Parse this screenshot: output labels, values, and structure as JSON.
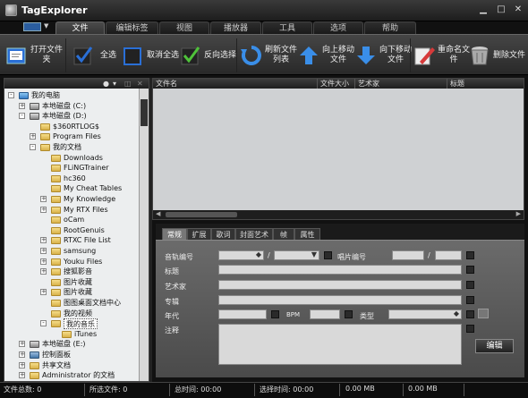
{
  "app": {
    "title": "TagExplorer"
  },
  "tabs": [
    "文件",
    "编辑标签",
    "视图",
    "播放器",
    "工具",
    "选项",
    "帮助"
  ],
  "ribbon": {
    "open_folder": "打开文件夹",
    "select_all": "全选",
    "deselect_all": "取消全选",
    "invert": "反向选择",
    "refresh": "刷新文件列表",
    "move_up": "向上移动文件",
    "move_down": "向下移动文件",
    "rename": "重命名文件",
    "delete": "删除文件"
  },
  "tree": [
    {
      "label": "我的电脑",
      "level": 0,
      "exp": "-",
      "icon": "computer"
    },
    {
      "label": "本地磁盘 (C:)",
      "level": 1,
      "exp": "+",
      "icon": "drive"
    },
    {
      "label": "本地磁盘 (D:)",
      "level": 1,
      "exp": "-",
      "icon": "drive"
    },
    {
      "label": "$360RTLOG$",
      "level": 2,
      "exp": "",
      "icon": "folder"
    },
    {
      "label": "Program Files",
      "level": 2,
      "exp": "+",
      "icon": "folder"
    },
    {
      "label": "我的文档",
      "level": 2,
      "exp": "-",
      "icon": "folder"
    },
    {
      "label": "Downloads",
      "level": 3,
      "exp": "",
      "icon": "folder"
    },
    {
      "label": "FLiNGTrainer",
      "level": 3,
      "exp": "",
      "icon": "folder"
    },
    {
      "label": "hc360",
      "level": 3,
      "exp": "",
      "icon": "folder"
    },
    {
      "label": "My Cheat Tables",
      "level": 3,
      "exp": "",
      "icon": "folder"
    },
    {
      "label": "My Knowledge",
      "level": 3,
      "exp": "+",
      "icon": "folder"
    },
    {
      "label": "My RTX Files",
      "level": 3,
      "exp": "+",
      "icon": "folder"
    },
    {
      "label": "oCam",
      "level": 3,
      "exp": "",
      "icon": "folder"
    },
    {
      "label": "RootGenuis",
      "level": 3,
      "exp": "",
      "icon": "folder"
    },
    {
      "label": "RTXC File List",
      "level": 3,
      "exp": "+",
      "icon": "folder"
    },
    {
      "label": "samsung",
      "level": 3,
      "exp": "+",
      "icon": "folder"
    },
    {
      "label": "Youku Files",
      "level": 3,
      "exp": "+",
      "icon": "folder"
    },
    {
      "label": "搜狐影音",
      "level": 3,
      "exp": "+",
      "icon": "folder"
    },
    {
      "label": "图片收藏",
      "level": 3,
      "exp": "",
      "icon": "folder"
    },
    {
      "label": "图片收藏",
      "level": 3,
      "exp": "+",
      "icon": "folder"
    },
    {
      "label": "图图桌面文档中心",
      "level": 3,
      "exp": "",
      "icon": "folder"
    },
    {
      "label": "我的视频",
      "level": 3,
      "exp": "",
      "icon": "folder"
    },
    {
      "label": "我的音乐",
      "level": 3,
      "exp": "-",
      "icon": "folder",
      "selected": true
    },
    {
      "label": "iTunes",
      "level": 4,
      "exp": "",
      "icon": "folder"
    },
    {
      "label": "本地磁盘 (E:)",
      "level": 1,
      "exp": "+",
      "icon": "drive"
    },
    {
      "label": "控制面板",
      "level": 1,
      "exp": "+",
      "icon": "panel"
    },
    {
      "label": "共享文档",
      "level": 1,
      "exp": "+",
      "icon": "folder"
    },
    {
      "label": "Administrator 的文档",
      "level": 1,
      "exp": "+",
      "icon": "folder"
    }
  ],
  "file_columns": [
    "文件名",
    "文件大小",
    "艺术家",
    "标题"
  ],
  "prop_tabs": [
    "常规",
    "扩展",
    "歌词",
    "封面艺术",
    "帧",
    "属性"
  ],
  "fields": {
    "disc_no": "音轨编号",
    "slash": "/",
    "disc": "唱片编号",
    "title": "标题",
    "artist": "艺术家",
    "album": "专辑",
    "year": "年代",
    "bpm": "BPM",
    "genre": "类型",
    "comment": "注释",
    "edit_btn": "编辑"
  },
  "status": {
    "total_files": "文件总数: 0",
    "selected_files": "所选文件: 0",
    "total_time": "总时间: 00:00",
    "selected_time": "选择时间: 00:00",
    "size1": "0.00 MB",
    "size2": "0.00 MB"
  },
  "colors": {
    "folder": "#e6c35a",
    "accent_blue": "#2a6fd6",
    "check_green": "#4fc23a"
  }
}
